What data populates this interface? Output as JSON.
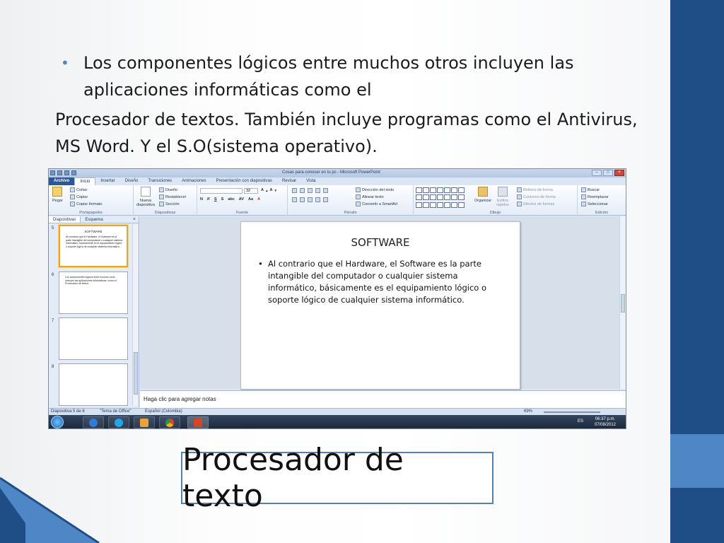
{
  "slide": {
    "bullet_text": "Los componentes lógicos entre muchos otros incluyen las aplicaciones informáticas como el",
    "paragraph": "Procesador de textos. También incluye programas como el Antivirus, MS Word. Y el S.O(sistema operativo).",
    "caption": "Procesador de texto"
  },
  "app": {
    "window_title": "Cosas para conocer en tu pc - Microsoft PowerPoint",
    "tabs": [
      "Archivo",
      "Inicio",
      "Insertar",
      "Diseño",
      "Transiciones",
      "Animaciones",
      "Presentación con diapositivas",
      "Revisar",
      "Vista"
    ],
    "ribbon": {
      "clipboard": {
        "paste": "Pegar",
        "cut": "Cortar",
        "copy": "Copiar",
        "format_painter": "Copiar formato",
        "group": "Portapapeles"
      },
      "slides": {
        "new_slide": "Nueva diapositiva",
        "layout": "Diseño",
        "reset": "Restablecer",
        "section": "Sección",
        "group": "Diapositivas"
      },
      "font": {
        "size": "32",
        "group": "Fuente"
      },
      "paragraph": {
        "text_direction": "Dirección del texto",
        "align_text": "Alinear texto",
        "smartart": "Convertir a SmartArt",
        "group": "Párrafo"
      },
      "drawing": {
        "arrange": "Organizar",
        "quick_styles": "Estilos rápidos",
        "fill": "Relleno de forma",
        "outline": "Contorno de forma",
        "effects": "Efectos de formas",
        "group": "Dibujo"
      },
      "editing": {
        "find": "Buscar",
        "replace": "Reemplazar",
        "select": "Seleccionar",
        "group": "Edición"
      }
    },
    "pane_tabs": [
      "Diapositivas",
      "Esquema"
    ],
    "thumbnails": [
      {
        "num": "5",
        "title": "SOFTWARE",
        "body": "Al contrario que el Hardware, el Software es la parte intangible del computador o cualquier sistema informático, básicamente es el equipamiento lógico o soporte lógico de cualquier sistema informático."
      },
      {
        "num": "6",
        "title": "",
        "body": "Los componentes lógicos entre muchos otros incluyen las aplicaciones informáticas, como el Procesador de textos"
      },
      {
        "num": "7",
        "title": "",
        "body": ""
      },
      {
        "num": "8",
        "title": "",
        "body": ""
      }
    ],
    "main_slide": {
      "title": "SOFTWARE",
      "body": "Al contrario que el Hardware, el Software es la parte intangible del computador o cualquier sistema informático, básicamente es el equipamiento lógico o soporte lógico de cualquier sistema informático."
    },
    "notes_placeholder": "Haga clic para agregar notas",
    "status": {
      "slide": "Diapositiva 5 de 8",
      "theme": "\"Tema de Office\"",
      "language": "Español (Colombia)",
      "zoom": "69%"
    },
    "taskbar": {
      "lang": "ES",
      "time": "06:37 p.m.",
      "date": "07/08/2012"
    }
  },
  "colors": {
    "accent_dark": "#1f4e86",
    "accent_light": "#4f86c6",
    "file_tab": "#2b5797",
    "selected_thumb": "#e5a52c"
  }
}
